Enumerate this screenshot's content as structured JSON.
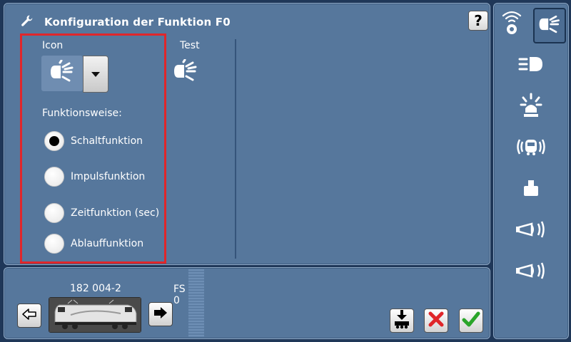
{
  "header": {
    "title": "Konfiguration der Funktion F0",
    "help_label": "?"
  },
  "config": {
    "icon_label": "Icon",
    "test_label": "Test",
    "selected_icon": "headlight-icon",
    "mode_label": "Funktionsweise:",
    "modes": [
      {
        "label": "Schaltfunktion",
        "checked": true
      },
      {
        "label": "Impulsfunktion",
        "checked": false
      },
      {
        "label": "Zeitfunktion (sec)",
        "checked": false
      },
      {
        "label": "Ablauffunktion",
        "checked": false
      }
    ]
  },
  "sidebar": {
    "icons": [
      "radio-signal-icon",
      "headlight-icon",
      "high-beam-icon",
      "cab-light-icon",
      "locomotive-sound-icon",
      "weight-icon",
      "horn-icon",
      "horn-2-icon"
    ],
    "active_index": 1
  },
  "loco": {
    "name": "182 004-2",
    "fs_label": "FS",
    "speed": "0"
  },
  "colors": {
    "panel": "#56779c",
    "background": "#1f3758",
    "highlight": "#e0262a",
    "cancel": "#e0262a",
    "confirm": "#2aa52a"
  }
}
